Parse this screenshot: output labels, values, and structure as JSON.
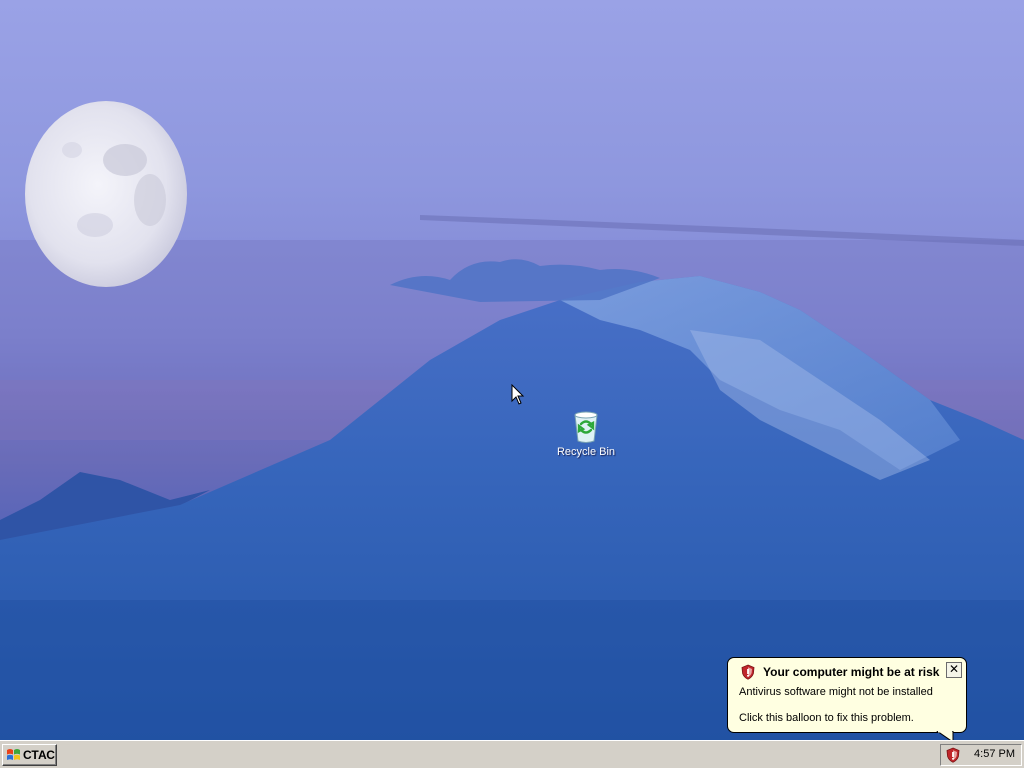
{
  "desktop": {
    "icons": [
      {
        "label": "Recycle Bin",
        "icon": "recycle-bin-icon"
      }
    ]
  },
  "balloon": {
    "title": "Your computer might be at risk",
    "line1": "Antivirus software might not be installed",
    "line2": "Click this balloon to fix this problem.",
    "close_glyph": "✕",
    "icon": "security-shield-icon"
  },
  "taskbar": {
    "start_label": "СТАС",
    "clock": "4:57 PM",
    "tray_icon": "security-shield-icon"
  },
  "colors": {
    "sky_top": "#9aa2e6",
    "mountain": "#2f5fb2",
    "taskbar": "#d4d0c8",
    "balloon_bg": "#ffffe1"
  }
}
